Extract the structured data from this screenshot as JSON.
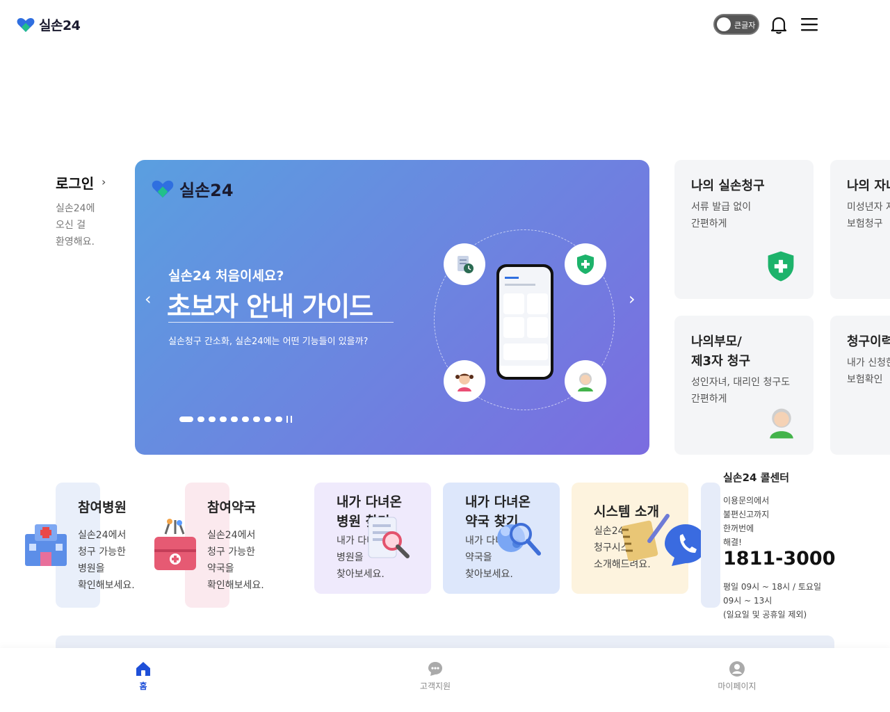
{
  "header": {
    "logo_text": "실손24",
    "toggle_label": "큰글자",
    "icons": [
      "heart-logo-icon",
      "bell-icon",
      "hamburger-menu-icon"
    ]
  },
  "login": {
    "title": "로그인",
    "desc_line1": "실손24에",
    "desc_line2": "오신 걸",
    "desc_line3": "환영해요."
  },
  "banner": {
    "logo_text": "실손24",
    "subtitle": "실손24 처음이세요?",
    "title": "초보자 안내 가이드",
    "desc": "실손청구 간소화, 실손24에는 어떤 기능들이 있을까?",
    "slide_count": 10,
    "active_slide": 1
  },
  "right_cards": [
    {
      "title_line1": "나의 실손청구",
      "title_line2": "",
      "desc_line1": "서류 발급 없이",
      "desc_line2": "간편하게",
      "icon": "shield-plus-icon"
    },
    {
      "title_line1": "나의 자녀",
      "title_line2": "",
      "desc_line1": "미성년자 자",
      "desc_line2": "보험청구",
      "icon": ""
    },
    {
      "title_line1": "나의부모/",
      "title_line2": "제3자 청구",
      "desc_line1": "성인자녀, 대리인 청구도",
      "desc_line2": "간편하게",
      "icon": "grandparent-icon"
    },
    {
      "title_line1": "청구이력",
      "title_line2": "",
      "desc_line1": "내가 신청한",
      "desc_line2": "보험확인",
      "icon": ""
    }
  ],
  "bottom_cards": [
    {
      "title_line1": "참여병원",
      "title_line2": "",
      "desc": [
        "실손24에서",
        "청구 가능한",
        "병원을",
        "확인해보세요."
      ],
      "icon": "hospital-icon",
      "bg": "#e9effa"
    },
    {
      "title_line1": "참여약국",
      "title_line2": "",
      "desc": [
        "실손24에서",
        "청구 가능한",
        "약국을",
        "확인해보세요."
      ],
      "icon": "medicine-box-icon",
      "bg": "#fbe9ee"
    },
    {
      "title_line1": "내가 다녀온",
      "title_line2": "병원 찾기",
      "desc": [
        "내가 다녀온",
        "병원을",
        "찾아보세요."
      ],
      "icon": "document-search-icon",
      "bg": "#efeafc"
    },
    {
      "title_line1": "내가 다녀온",
      "title_line2": "약국 찾기",
      "desc": [
        "내가 다녀온",
        "약국을",
        "찾아보세요."
      ],
      "icon": "pill-search-icon",
      "bg": "#dde7fb"
    },
    {
      "title_line1": "시스템 소개",
      "title_line2": "",
      "desc": [
        "실손24",
        "청구시스템",
        "소개해드려요."
      ],
      "icon": "notebook-pen-icon",
      "bg": "#fdf3de"
    }
  ],
  "call_center": {
    "title": "실손24 콜센터",
    "desc_line1": "이용문의에서",
    "desc_line2": "불편신고까지",
    "desc_line3": "한꺼번에",
    "desc_line4": "해결!",
    "phone": "1811-3000",
    "hours_line1": "평일 09시 ~ 18시 / 토요일",
    "hours_line2": "09시 ~ 13시",
    "hours_line3": "(일요일 및 공휴일 제외)"
  },
  "bottom_nav": [
    {
      "label": "홈",
      "icon": "home-icon",
      "active": true
    },
    {
      "label": "고객지원",
      "icon": "chat-bubble-icon",
      "active": false
    },
    {
      "label": "마이페이지",
      "icon": "user-icon",
      "active": false
    }
  ],
  "colors": {
    "accent": "#1e4fd8",
    "brand_green": "#1db36b",
    "banner_start": "#5a9fe0",
    "banner_end": "#7b6ce0"
  }
}
